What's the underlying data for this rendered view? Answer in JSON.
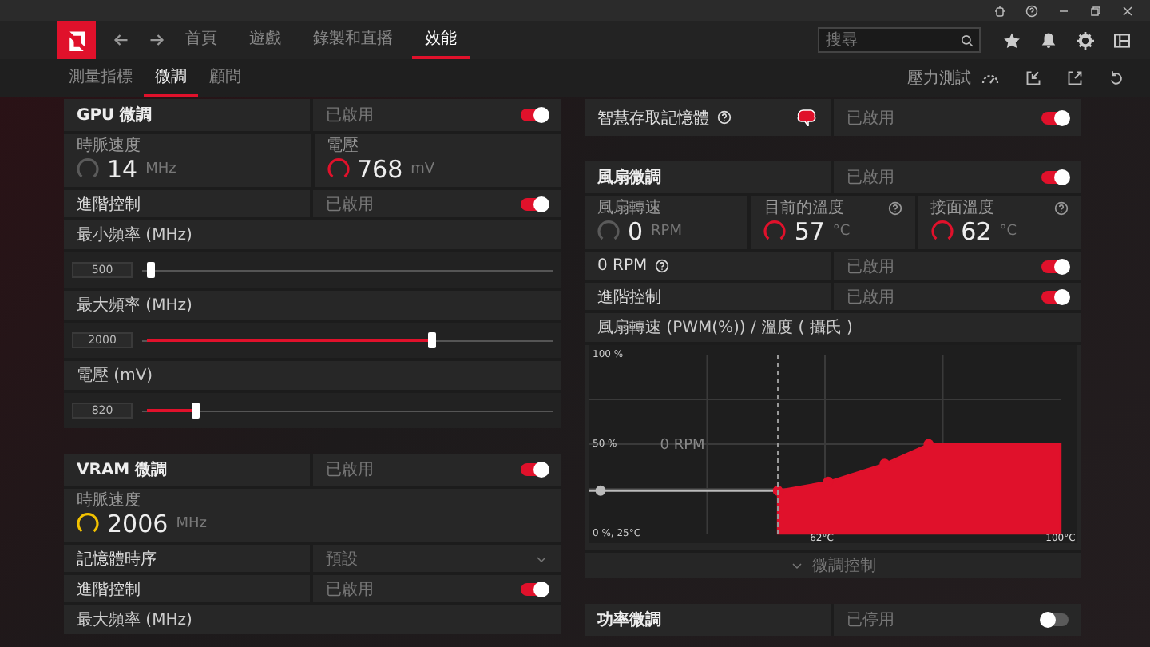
{
  "nav": {
    "tabs": [
      {
        "label": "首頁",
        "selected": false
      },
      {
        "label": "遊戲",
        "selected": false
      },
      {
        "label": "錄製和直播",
        "selected": false
      },
      {
        "label": "效能",
        "selected": true
      }
    ],
    "search": {
      "placeholder": "搜尋"
    }
  },
  "subtabs": [
    {
      "label": "測量指標",
      "selected": false
    },
    {
      "label": "微調",
      "selected": true
    },
    {
      "label": "顧問",
      "selected": false
    }
  ],
  "toolbar": {
    "stress_test": "壓力測試"
  },
  "left_panels": [
    {
      "title": "GPU 微調",
      "status": "已啟用",
      "on": true,
      "rows": [
        {
          "kind": "metrics",
          "items": [
            {
              "label": "時脈速度",
              "value": "14",
              "unit": "MHz",
              "color": "#5a5a5a"
            },
            {
              "label": "電壓",
              "value": "768",
              "unit": "mV",
              "color": "#e0112b"
            }
          ]
        },
        {
          "kind": "toggle",
          "label": "進階控制",
          "status": "已啟用",
          "on": true
        },
        {
          "kind": "label",
          "label": "最小頻率 (MHz)"
        },
        {
          "kind": "slider",
          "value": "500",
          "level": 0.01
        },
        {
          "kind": "label",
          "label": "最大頻率 (MHz)"
        },
        {
          "kind": "slider",
          "value": "2000",
          "level": 0.71
        },
        {
          "kind": "label",
          "label": "電壓 (mV)"
        },
        {
          "kind": "slider",
          "value": "820",
          "level": 0.12
        }
      ]
    },
    {
      "title": "VRAM 微調",
      "status": "已啟用",
      "on": true,
      "rows": [
        {
          "kind": "metrics",
          "items": [
            {
              "label": "時脈速度",
              "value": "2006",
              "unit": "MHz",
              "color": "#f2c200"
            }
          ]
        },
        {
          "kind": "dropdown",
          "label": "記憶體時序",
          "value": "預設"
        },
        {
          "kind": "toggle",
          "label": "進階控制",
          "status": "已啟用",
          "on": true
        },
        {
          "kind": "label",
          "label": "最大頻率 (MHz)"
        }
      ]
    }
  ],
  "right_panels": [
    {
      "kind": "feature",
      "label": "智慧存取記憶體",
      "help": true,
      "status": "已啟用",
      "on": true
    },
    {
      "kind": "panel",
      "title": "風扇微調",
      "status": "已啟用",
      "on": true,
      "rows": [
        {
          "kind": "metrics",
          "items": [
            {
              "label": "風扇轉速",
              "value": "0",
              "unit": "RPM",
              "color": "#5a5a5a",
              "help": false
            },
            {
              "label": "目前的溫度",
              "value": "57",
              "unit": "°C",
              "color": "#e0112b",
              "help": true
            },
            {
              "label": "接面溫度",
              "value": "62",
              "unit": "°C",
              "color": "#e0112b",
              "help": true
            }
          ]
        },
        {
          "kind": "toggle",
          "label": "0 RPM",
          "help": true,
          "status": "已啟用",
          "on": true
        },
        {
          "kind": "toggle",
          "label": "進階控制",
          "help": false,
          "status": "已啟用",
          "on": true
        },
        {
          "kind": "label",
          "label": "風扇轉速 (PWM(%)) / 溫度 ( 攝氏 )"
        },
        {
          "kind": "chart",
          "overlay_label": "0 RPM",
          "chart_data": {
            "type": "area",
            "x": [
              55,
              63,
              72,
              79,
              100
            ],
            "series": [
              {
                "color": "#e0112b",
                "values": [
                  24,
                  29,
                  39,
                  50,
                  50
                ]
              }
            ],
            "xlim": [
              25,
              100
            ],
            "ylim": [
              0,
              100
            ],
            "ref_lines": [
              {
                "axis": "x",
                "value": 55
              }
            ],
            "xticks": [
              {
                "value": 62,
                "label": "62°C"
              },
              {
                "value": 100,
                "label": "100°C"
              }
            ],
            "yticks": [
              {
                "value": 100,
                "label": "100 %"
              },
              {
                "value": 50,
                "label": "50 %"
              },
              {
                "value": 0,
                "label": "0 %, 25°C"
              }
            ]
          }
        },
        {
          "kind": "expander",
          "label": "微調控制"
        }
      ]
    },
    {
      "kind": "panel",
      "title": "功率微調",
      "status": "已停用",
      "on": false
    }
  ]
}
